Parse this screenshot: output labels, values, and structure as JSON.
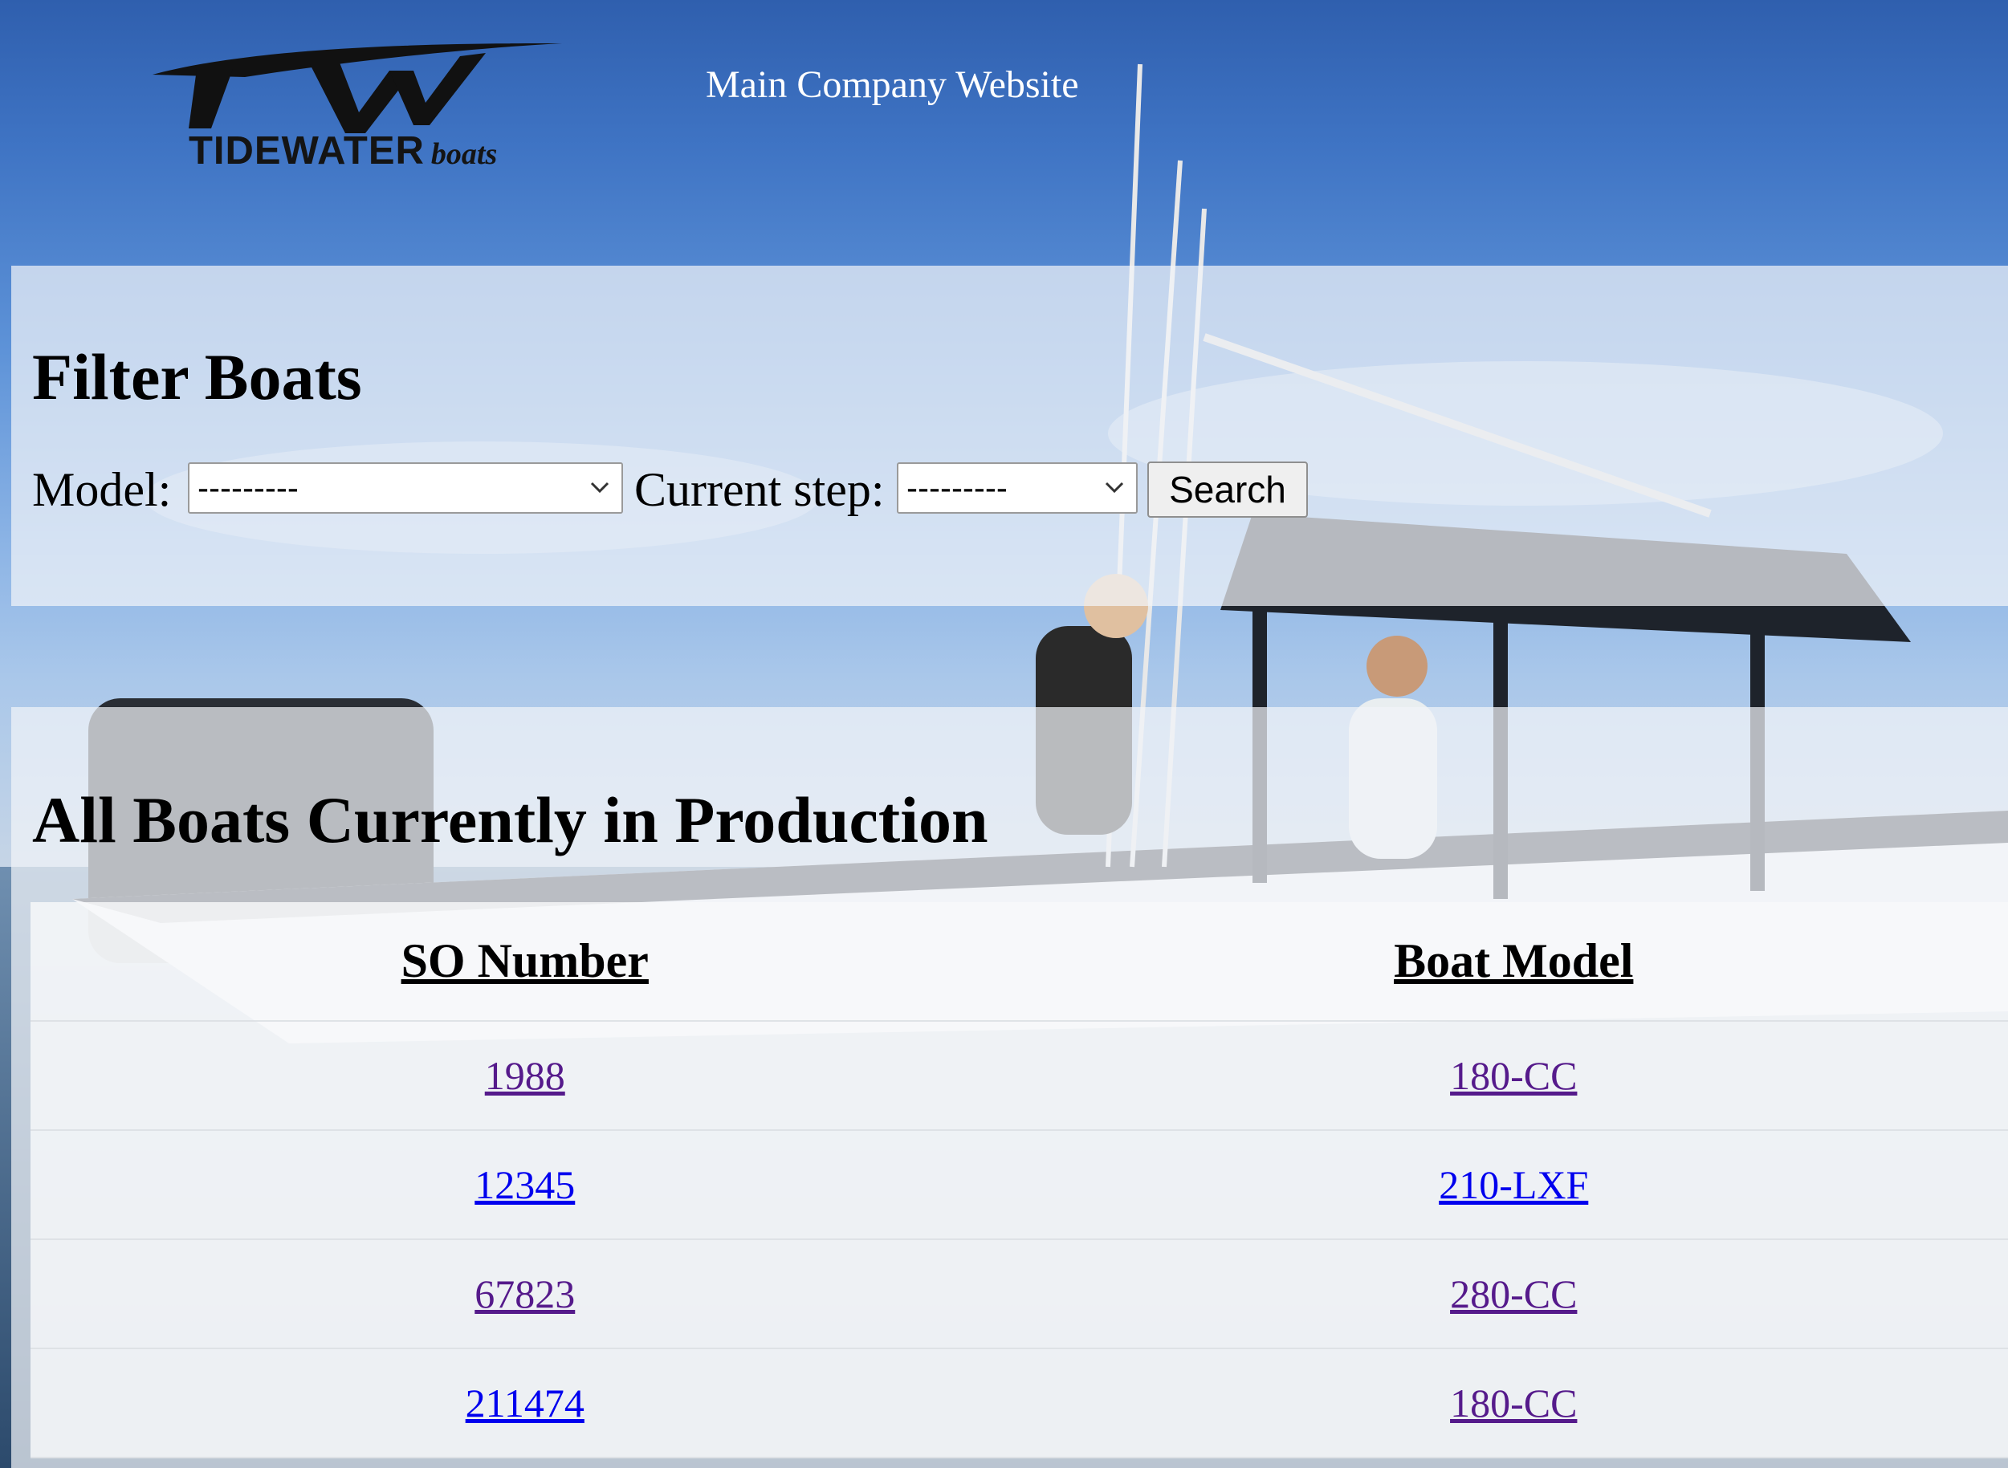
{
  "header": {
    "logo": {
      "brand_text": "TIDEWATER",
      "brand_sub": "boats"
    },
    "main_link_label": "Main Company Website"
  },
  "filter": {
    "title": "Filter Boats",
    "model_label": "Model:",
    "model_value": "---------",
    "step_label": "Current step:",
    "step_value": "---------",
    "search_label": "Search"
  },
  "production": {
    "title": "All Boats Currently in Production",
    "columns": [
      "SO Number",
      "Boat Model"
    ],
    "rows": [
      {
        "so": "1988",
        "model": "180-CC",
        "visited": true
      },
      {
        "so": "12345",
        "model": "210-LXF",
        "visited": false
      },
      {
        "so": "67823",
        "model": "280-CC",
        "visited": true
      },
      {
        "so": "211474",
        "model": "180-CC",
        "visited": false
      }
    ]
  },
  "colors": {
    "link_visited": "#551a8b",
    "link_unvisited": "#0000ee",
    "sky": "#3f74c4"
  }
}
